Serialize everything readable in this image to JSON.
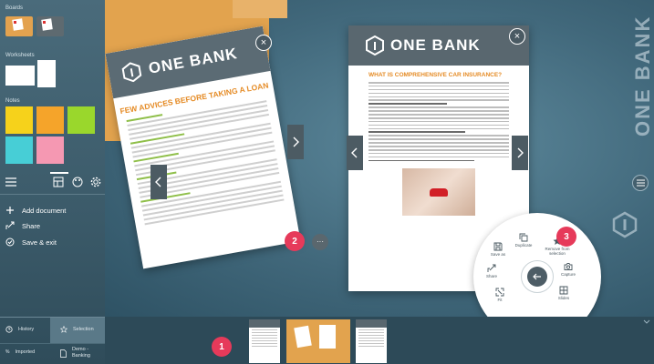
{
  "sidebar": {
    "boards_label": "Boards",
    "worksheets_label": "Worksheets",
    "notes_label": "Notes",
    "note_colors": [
      "#f6d21b",
      "#f5a42a",
      "#9ad72c",
      "#47ced6",
      "#f598b2"
    ],
    "menu": [
      {
        "label": "Add document",
        "icon": "plus-icon"
      },
      {
        "label": "Share",
        "icon": "share-icon"
      },
      {
        "label": "Save & exit",
        "icon": "check-circle-icon"
      }
    ],
    "bottom": {
      "history": "History",
      "selection": "Selection",
      "imported": "Imported",
      "demo": "Demo -\nBanking"
    }
  },
  "documents": {
    "left": {
      "brand": "ONE BANK",
      "title": "FEW ADVICES BEFORE TAKING A LOAN"
    },
    "right": {
      "brand": "ONE BANK",
      "title": "WHAT IS COMPREHENSIVE CAR INSURANCE?"
    }
  },
  "watermark": "ONE BANK",
  "radial_menu": {
    "items": [
      {
        "label": "Duplicate",
        "icon": "duplicate-icon"
      },
      {
        "label": "Remove from\nselection",
        "icon": "star-icon"
      },
      {
        "label": "Save as",
        "icon": "save-icon"
      },
      {
        "label": "Capture",
        "icon": "camera-icon"
      },
      {
        "label": "Share",
        "icon": "share-icon"
      },
      {
        "label": "Slides",
        "icon": "grid-icon"
      },
      {
        "label": "Fit",
        "icon": "fit-icon"
      }
    ]
  },
  "badges": [
    "1",
    "2",
    "3"
  ],
  "colors": {
    "accent_badge": "#e63a5a",
    "brand_orange": "#e58b25",
    "header_gray": "#59676f"
  }
}
